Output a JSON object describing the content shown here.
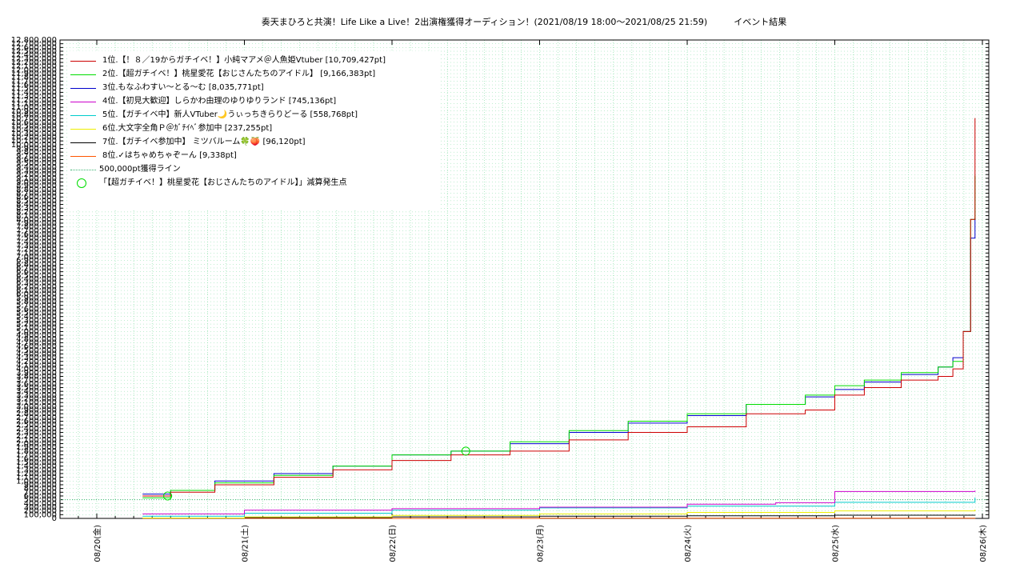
{
  "title": "奏天まひろと共演！Life Like a Live！2出演権獲得オーディション！(2021/08/19 18:00〜2021/08/25 21:59)　　　イベント結果",
  "legend": [
    {
      "label": "1位.【！８／19からガチイベ！】小純マアメ＠人魚姫Vtuber [10,709,427pt]",
      "color": "#cc0000"
    },
    {
      "label": "2位.【超ガチイベ！】桃星愛花【おじさんたちのアイドル】 [9,166,383pt]",
      "color": "#00dd00"
    },
    {
      "label": "3位.もなふわすい〜とる〜む [8,035,771pt]",
      "color": "#0000cc"
    },
    {
      "label": "4位.【初見大歓迎】しらかわ由理のゆりゆりランド [745,136pt]",
      "color": "#cc00cc"
    },
    {
      "label": "5位.【ガチイベ中】新人VTuber🌙うぃっちきらりどーる [558,768pt]",
      "color": "#00cccc"
    },
    {
      "label": "6位.大文字全角Ｐ＠ｶﾞﾁｲﾍﾞ参加中 [237,255pt]",
      "color": "#eeee00"
    },
    {
      "label": "7位.【ガチイベ参加中】 ミツバルーム🍀🍑 [96,120pt]",
      "color": "#000000"
    },
    {
      "label": "8位.✓はちゃめちゃぞーん [9,338pt]",
      "color": "#ff5500"
    },
    {
      "label": "500,000pt獲得ライン",
      "color": "#3cb371"
    },
    {
      "label": "「【超ガチイベ！】桃星愛花【おじさんたちのアイドル】」減算発生点",
      "color": "#00dd00"
    }
  ],
  "chart_data": {
    "type": "line",
    "title": "奏天まひろと共演！Life Like a Live！2出演権獲得オーディション！(2021/08/19 18:00〜2021/08/25 21:59)　　　イベント結果",
    "xlabel": "",
    "ylabel": "",
    "x_ticks": [
      "08/20(金)",
      "08/21(土)",
      "08/22(日)",
      "08/23(月)",
      "08/24(火)",
      "08/25(水)",
      "08/26(木)"
    ],
    "x_range_days": [
      0,
      6
    ],
    "ylim": [
      0,
      12800000
    ],
    "y_tick_step": 100000,
    "grid": true,
    "legend_position": "top-left",
    "reference_line": {
      "name": "500,000pt獲得ライン",
      "value": 500000
    },
    "series": [
      {
        "name": "1位.【！８／19からガチイベ！】小純マアメ＠人魚姫Vtuber [10,709,427pt]",
        "x": [
          0.31,
          0.5,
          0.8,
          1.2,
          1.6,
          2.0,
          2.4,
          2.8,
          3.2,
          3.6,
          4.0,
          4.4,
          4.8,
          5.0,
          5.2,
          5.45,
          5.7,
          5.8,
          5.87,
          5.92,
          5.95
        ],
        "y": [
          600000,
          700000,
          900000,
          1100000,
          1300000,
          1550000,
          1700000,
          1800000,
          2100000,
          2300000,
          2450000,
          2800000,
          2900000,
          3300000,
          3500000,
          3700000,
          3800000,
          4000000,
          5000000,
          8000000,
          10709427
        ]
      },
      {
        "name": "2位.【超ガチイベ！】桃星愛花【おじさんたちのアイドル】 [9,166,383pt]",
        "x": [
          0.31,
          0.5,
          0.8,
          1.2,
          1.6,
          2.0,
          2.4,
          2.8,
          3.2,
          3.6,
          4.0,
          4.4,
          4.8,
          5.0,
          5.2,
          5.45,
          5.7,
          5.8,
          5.87,
          5.92,
          5.95
        ],
        "y": [
          550000,
          750000,
          950000,
          1150000,
          1400000,
          1700000,
          1800000,
          2050000,
          2350000,
          2600000,
          2800000,
          3050000,
          3300000,
          3550000,
          3700000,
          3900000,
          4050000,
          4200000,
          5000000,
          8000000,
          9166383
        ]
      },
      {
        "name": "3位.もなふわすい〜とる〜む [8,035,771pt]",
        "x": [
          0.31,
          0.5,
          0.8,
          1.2,
          1.6,
          2.0,
          2.4,
          2.8,
          3.2,
          3.6,
          4.0,
          4.4,
          4.8,
          5.0,
          5.2,
          5.45,
          5.7,
          5.8,
          5.87,
          5.92,
          5.95
        ],
        "y": [
          650000,
          750000,
          1000000,
          1200000,
          1400000,
          1700000,
          1800000,
          2000000,
          2300000,
          2550000,
          2750000,
          3050000,
          3250000,
          3450000,
          3650000,
          3850000,
          4050000,
          4300000,
          5000000,
          7500000,
          8035771
        ]
      },
      {
        "name": "4位.【初見大歓迎】しらかわ由理のゆりゆりランド [745,136pt]",
        "x": [
          0.31,
          1.0,
          2.0,
          3.0,
          4.0,
          4.6,
          4.85,
          5.0,
          5.95
        ],
        "y": [
          120000,
          220000,
          260000,
          300000,
          380000,
          420000,
          420000,
          720000,
          745136
        ]
      },
      {
        "name": "5位.【ガチイベ中】新人VTuber🌙うぃっちきらりどーる [558,768pt]",
        "x": [
          0.31,
          1.0,
          2.0,
          3.0,
          4.0,
          5.0,
          5.95
        ],
        "y": [
          60000,
          140000,
          220000,
          280000,
          330000,
          430000,
          558768
        ]
      },
      {
        "name": "6位.大文字全角Ｐ＠ｶﾞﾁｲﾍﾞ参加中 [237,255pt]",
        "x": [
          0.31,
          1.0,
          2.0,
          3.0,
          4.0,
          5.0,
          5.95
        ],
        "y": [
          10000,
          40000,
          80000,
          120000,
          160000,
          200000,
          237255
        ]
      },
      {
        "name": "7位.【ガチイベ参加中】 ミツバルーム🍀🍑 [96,120pt]",
        "x": [
          0.31,
          1.0,
          2.0,
          3.0,
          4.0,
          5.0,
          5.95
        ],
        "y": [
          5000,
          20000,
          40000,
          60000,
          70000,
          85000,
          96120
        ]
      },
      {
        "name": "8位.✓はちゃめちゃぞーん [9,338pt]",
        "x": [
          0.31,
          3.0,
          5.95
        ],
        "y": [
          0,
          5000,
          9338
        ]
      }
    ],
    "markers": [
      {
        "name": "「【超ガチイベ！】桃星愛花【おじさんたちのアイドル】」減算発生点",
        "x": [
          0.48,
          2.5
        ],
        "y": [
          600000,
          1800000
        ]
      }
    ]
  }
}
